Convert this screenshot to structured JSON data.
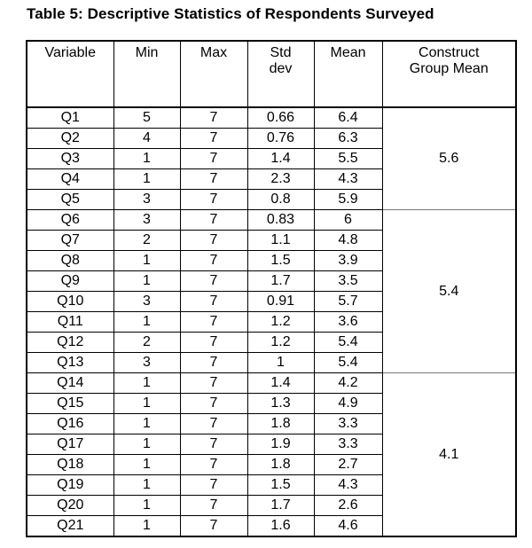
{
  "title": "Table 5: Descriptive Statistics of Respondents Surveyed",
  "headers": {
    "variable": "Variable",
    "min": "Min",
    "max": "Max",
    "std_line1": "Std",
    "std_line2": "dev",
    "mean": "Mean",
    "group_line1": "Construct",
    "group_line2": "Group Mean"
  },
  "rows": [
    {
      "variable": "Q1",
      "min": "5",
      "max": "7",
      "std": "0.66",
      "mean": "6.4"
    },
    {
      "variable": "Q2",
      "min": "4",
      "max": "7",
      "std": "0.76",
      "mean": "6.3"
    },
    {
      "variable": "Q3",
      "min": "1",
      "max": "7",
      "std": "1.4",
      "mean": "5.5"
    },
    {
      "variable": "Q4",
      "min": "1",
      "max": "7",
      "std": "2.3",
      "mean": "4.3"
    },
    {
      "variable": "Q5",
      "min": "3",
      "max": "7",
      "std": "0.8",
      "mean": "5.9"
    },
    {
      "variable": "Q6",
      "min": "3",
      "max": "7",
      "std": "0.83",
      "mean": "6"
    },
    {
      "variable": "Q7",
      "min": "2",
      "max": "7",
      "std": "1.1",
      "mean": "4.8"
    },
    {
      "variable": "Q8",
      "min": "1",
      "max": "7",
      "std": "1.5",
      "mean": "3.9"
    },
    {
      "variable": "Q9",
      "min": "1",
      "max": "7",
      "std": "1.7",
      "mean": "3.5"
    },
    {
      "variable": "Q10",
      "min": "3",
      "max": "7",
      "std": "0.91",
      "mean": "5.7"
    },
    {
      "variable": "Q11",
      "min": "1",
      "max": "7",
      "std": "1.2",
      "mean": "3.6"
    },
    {
      "variable": "Q12",
      "min": "2",
      "max": "7",
      "std": "1.2",
      "mean": "5.4"
    },
    {
      "variable": "Q13",
      "min": "3",
      "max": "7",
      "std": "1",
      "mean": "5.4"
    },
    {
      "variable": "Q14",
      "min": "1",
      "max": "7",
      "std": "1.4",
      "mean": "4.2"
    },
    {
      "variable": "Q15",
      "min": "1",
      "max": "7",
      "std": "1.3",
      "mean": "4.9"
    },
    {
      "variable": "Q16",
      "min": "1",
      "max": "7",
      "std": "1.8",
      "mean": "3.3"
    },
    {
      "variable": "Q17",
      "min": "1",
      "max": "7",
      "std": "1.9",
      "mean": "3.3"
    },
    {
      "variable": "Q18",
      "min": "1",
      "max": "7",
      "std": "1.8",
      "mean": "2.7"
    },
    {
      "variable": "Q19",
      "min": "1",
      "max": "7",
      "std": "1.5",
      "mean": "4.3"
    },
    {
      "variable": "Q20",
      "min": "1",
      "max": "7",
      "std": "1.7",
      "mean": "2.6"
    },
    {
      "variable": "Q21",
      "min": "1",
      "max": "7",
      "std": "1.6",
      "mean": "4.6"
    }
  ],
  "groups": [
    {
      "value": "5.6",
      "span": 5
    },
    {
      "value": "5.4",
      "span": 8
    },
    {
      "value": "4.1",
      "span": 8
    }
  ]
}
